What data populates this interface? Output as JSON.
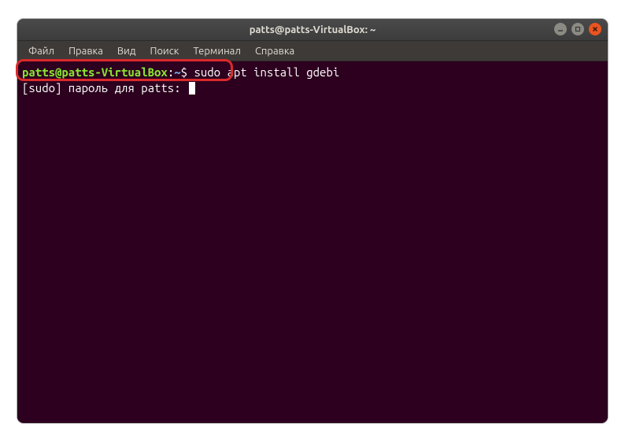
{
  "window": {
    "title": "patts@patts-VirtualBox: ~"
  },
  "menu": {
    "file": "Файл",
    "edit": "Правка",
    "view": "Вид",
    "search": "Поиск",
    "terminal": "Терминал",
    "help": "Справка"
  },
  "prompt": {
    "userhost": "patts@patts-VirtualBox",
    "colon": ":",
    "path": "~",
    "symbol": "$"
  },
  "terminal": {
    "command": "sudo apt install gdebi",
    "sudo_prompt": "[sudo] пароль для patts: "
  },
  "icons": {
    "minimize": "minimize-icon",
    "maximize": "maximize-icon",
    "close": "close-icon"
  },
  "colors": {
    "window_bg": "#2c001e",
    "titlebar": "#3c3c3c",
    "close_btn": "#e95420",
    "highlight": "#d92a2a"
  }
}
